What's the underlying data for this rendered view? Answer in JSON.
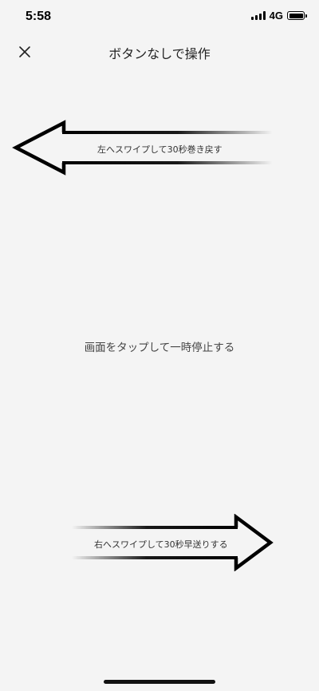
{
  "status_bar": {
    "time": "5:58",
    "network": "4G",
    "signal_icon": "cellular-signal-icon",
    "battery_icon": "battery-icon",
    "battery_level": 1.0
  },
  "header": {
    "title": "ボタンなしで操作",
    "close_icon": "close-icon"
  },
  "gestures": {
    "left_swipe_label": "左へスワイプして30秒巻き戻す",
    "right_swipe_label": "右へスワイプして30秒早送りする",
    "center_tap_label": "画面をタップして一時停止する"
  }
}
